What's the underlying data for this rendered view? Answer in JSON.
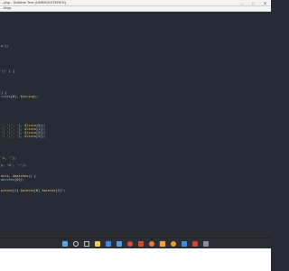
{
  "window": {
    "title": "...php - Sublime Text (UNREGISTERED)",
    "menu_label": "...ttings",
    "controls": {
      "minimize": "–",
      "maximize": "□",
      "close": "✕"
    }
  },
  "editor": {
    "lines": [
      {
        "line": 10,
        "tokens": [
          {
            "t": "pl",
            "text": "x');"
          }
        ]
      },
      {
        "line": 17,
        "tokens": [
          {
            "t": "pl",
            "text": "\")' ) {"
          }
        ]
      },
      {
        "line": 23,
        "tokens": [
          {
            "t": "pl",
            "text": ") {"
          }
        ]
      },
      {
        "line": 24,
        "tokens": [
          {
            "t": "fn",
            "text": "tches"
          },
          {
            "t": "pl",
            "text": "[0], "
          },
          {
            "t": "var",
            "text": "$string"
          },
          {
            "t": "pl",
            "text": ");"
          }
        ]
      },
      {
        "line": 32,
        "tokens": [
          {
            "t": "str",
            "text": "', ';', '"
          },
          {
            "t": "pl",
            "text": "), "
          },
          {
            "t": "var",
            "text": "$lista"
          },
          {
            "t": "pl",
            "text": "[0]);"
          }
        ]
      },
      {
        "line": 33,
        "tokens": [
          {
            "t": "str",
            "text": "'; ';', '"
          },
          {
            "t": "pl",
            "text": "), "
          },
          {
            "t": "var",
            "text": "$lista"
          },
          {
            "t": "pl",
            "text": "[1]);"
          }
        ]
      },
      {
        "line": 34,
        "tokens": [
          {
            "t": "str",
            "text": "'; ';', '"
          },
          {
            "t": "pl",
            "text": "), "
          },
          {
            "t": "var",
            "text": "$lista"
          },
          {
            "t": "pl",
            "text": "[2]);"
          }
        ]
      },
      {
        "line": 35,
        "tokens": [
          {
            "t": "str",
            "text": "'; ';', '"
          },
          {
            "t": "pl",
            "text": "), "
          },
          {
            "t": "var",
            "text": "$lista"
          },
          {
            "t": "pl",
            "text": "[3]);"
          }
        ]
      },
      {
        "line": 41,
        "tokens": [
          {
            "t": "str",
            "text": "'s, '"
          },
          {
            "t": "pl",
            "text": "');"
          }
        ]
      },
      {
        "line": 43,
        "tokens": [
          {
            "t": "pl",
            "text": "y, "
          },
          {
            "t": "str",
            "text": "'O'"
          },
          {
            "t": "pl",
            "text": ", "
          },
          {
            "t": "str",
            "text": "';'"
          },
          {
            "t": "pl",
            "text": ");"
          }
        ]
      },
      {
        "line": 46,
        "tokens": [
          {
            "t": "var",
            "text": "ents"
          },
          {
            "t": "pl",
            "text": ", "
          },
          {
            "t": "var",
            "text": "$matches"
          },
          {
            "t": "pl",
            "text": ")) {"
          }
        ]
      },
      {
        "line": 47,
        "tokens": [
          {
            "t": "fn",
            "text": "matches"
          },
          {
            "t": "pl",
            "text": "[0]);"
          }
        ]
      },
      {
        "line": 50,
        "tokens": [
          {
            "t": "var",
            "text": "pieces"
          },
          {
            "t": "pl",
            "text": "[1] "
          },
          {
            "t": "var",
            "text": "$pieces"
          },
          {
            "t": "pl",
            "text": "[0] "
          },
          {
            "t": "var",
            "text": "$pieces"
          },
          {
            "t": "pl",
            "text": "[1]\";"
          }
        ]
      }
    ]
  },
  "taskbar": {
    "apps": [
      {
        "id": "start",
        "icon": "windows-start-icon",
        "color": "#5aa7e6",
        "active": false
      },
      {
        "id": "search",
        "icon": "search-icon",
        "color": "#d7d7d7",
        "active": false
      },
      {
        "id": "task-view",
        "icon": "task-view-icon",
        "color": "#bdbdbd",
        "active": false
      },
      {
        "id": "explorer",
        "icon": "file-explorer-icon",
        "color": "#f2c84b",
        "active": false
      },
      {
        "id": "store",
        "icon": "store-icon",
        "color": "#3a8ee6",
        "active": false
      },
      {
        "id": "mail",
        "icon": "mail-icon",
        "color": "#4d9fe8",
        "active": false
      },
      {
        "id": "chrome",
        "icon": "chrome-icon",
        "color": "#e2493b",
        "active": false
      },
      {
        "id": "ppt",
        "icon": "powerpoint-icon",
        "color": "#d04a2b",
        "active": false
      },
      {
        "id": "xampp",
        "icon": "xampp-icon",
        "color": "#f07a2b",
        "active": false
      },
      {
        "id": "sublime",
        "icon": "sublime-text-icon",
        "color": "#ff9a3d",
        "active": true
      },
      {
        "id": "firefox",
        "icon": "firefox-icon",
        "color": "#f39a2c",
        "active": false
      },
      {
        "id": "app-blue",
        "icon": "app-blue-icon",
        "color": "#3b8fd9",
        "active": false
      },
      {
        "id": "app-red",
        "icon": "app-red-icon",
        "color": "#d9433b",
        "active": false
      },
      {
        "id": "terminal",
        "icon": "terminal-icon",
        "color": "#8a8f96",
        "active": false
      }
    ]
  }
}
